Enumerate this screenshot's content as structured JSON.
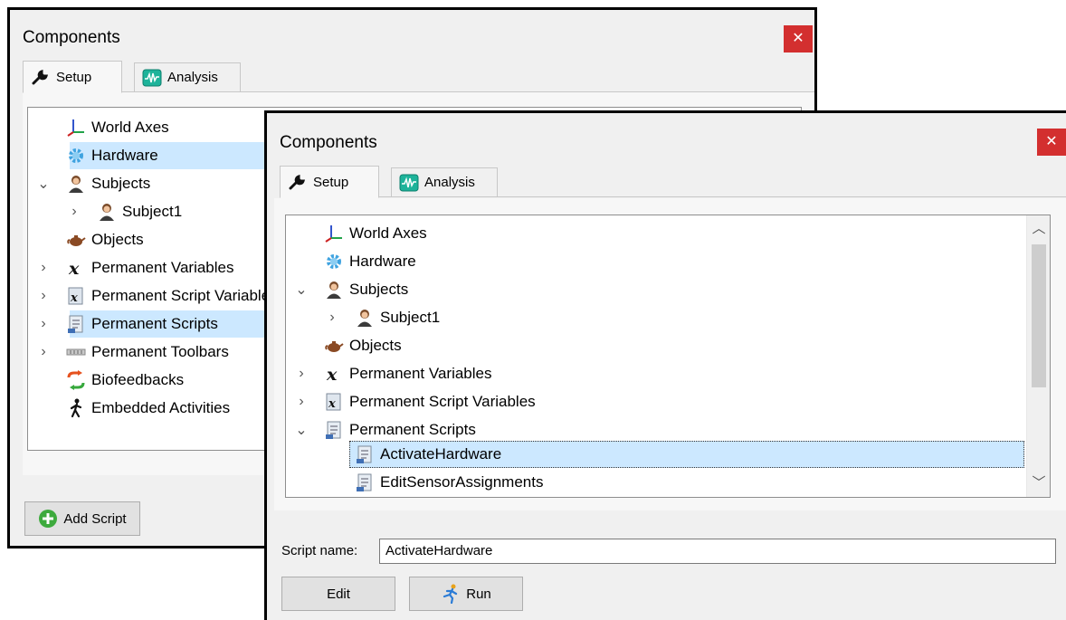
{
  "back_window": {
    "title": "Components",
    "close_glyph": "✕",
    "tabs": [
      {
        "label": "Setup",
        "icon": "wrench-icon",
        "active": true
      },
      {
        "label": "Analysis",
        "icon": "waveform-icon",
        "active": false
      }
    ],
    "tree": [
      {
        "label": "World Axes",
        "icon": "axes-icon",
        "expander": ""
      },
      {
        "label": "Hardware",
        "icon": "gear-icon",
        "expander": "",
        "selected": true
      },
      {
        "label": "Subjects",
        "icon": "person-icon",
        "expander": "⌄"
      },
      {
        "label": "Subject1",
        "icon": "person-icon",
        "expander": "›"
      },
      {
        "label": "Objects",
        "icon": "teapot-icon",
        "expander": ""
      },
      {
        "label": "Permanent Variables",
        "icon": "variable-x-icon",
        "expander": "›"
      },
      {
        "label": "Permanent Script Variables",
        "icon": "script-variable-icon",
        "expander": "›"
      },
      {
        "label": "Permanent Scripts",
        "icon": "script-icon",
        "expander": "›",
        "selected": true
      },
      {
        "label": "Permanent Toolbars",
        "icon": "toolbar-icon",
        "expander": "›"
      },
      {
        "label": "Biofeedbacks",
        "icon": "biofeedback-icon",
        "expander": ""
      },
      {
        "label": "Embedded Activities",
        "icon": "walking-icon",
        "expander": ""
      }
    ],
    "add_script_label": "Add Script"
  },
  "front_window": {
    "title": "Components",
    "close_glyph": "✕",
    "tabs": [
      {
        "label": "Setup",
        "icon": "wrench-icon",
        "active": true
      },
      {
        "label": "Analysis",
        "icon": "waveform-icon",
        "active": false
      }
    ],
    "tree": [
      {
        "label": "World Axes",
        "icon": "axes-icon",
        "expander": ""
      },
      {
        "label": "Hardware",
        "icon": "gear-icon",
        "expander": ""
      },
      {
        "label": "Subjects",
        "icon": "person-icon",
        "expander": "⌄"
      },
      {
        "label": "Subject1",
        "icon": "person-icon",
        "expander": "›"
      },
      {
        "label": "Objects",
        "icon": "teapot-icon",
        "expander": ""
      },
      {
        "label": "Permanent Variables",
        "icon": "variable-x-icon",
        "expander": "›"
      },
      {
        "label": "Permanent Script Variables",
        "icon": "script-variable-icon",
        "expander": "›"
      },
      {
        "label": "Permanent Scripts",
        "icon": "script-icon",
        "expander": "⌄"
      },
      {
        "label": "ActivateHardware",
        "icon": "script-icon",
        "expander": "",
        "selected": true
      },
      {
        "label": "EditSensorAssignments",
        "icon": "script-icon",
        "expander": ""
      }
    ],
    "script_name_label": "Script name:",
    "script_name_value": "ActivateHardware",
    "edit_label": "Edit",
    "run_label": "Run"
  },
  "colors": {
    "selection": "#cce8ff",
    "close": "#d32f2f"
  }
}
